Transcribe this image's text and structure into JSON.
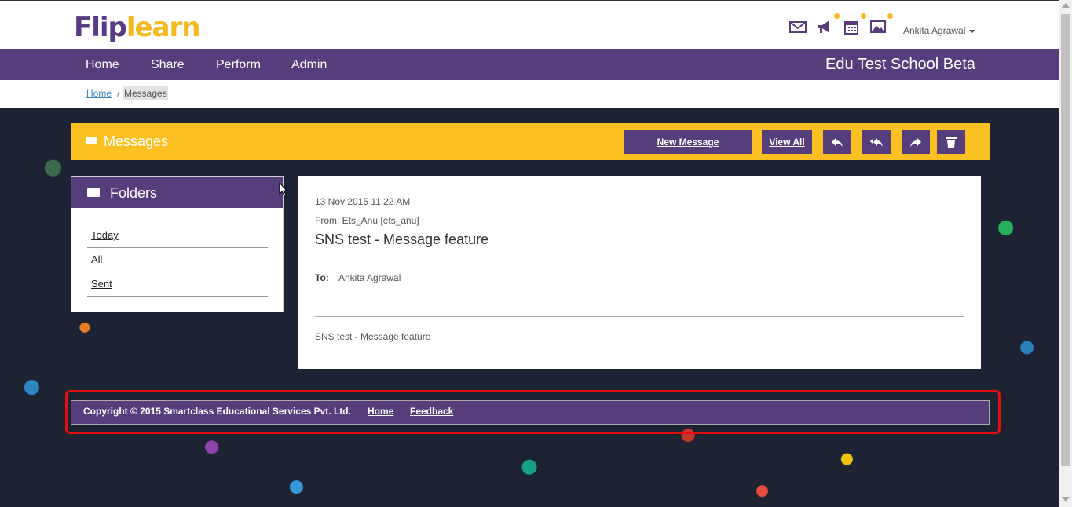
{
  "brand": {
    "logo_part1": "Flip",
    "logo_part2": "learn"
  },
  "header": {
    "user_name": "Ankita Agrawal",
    "icons": [
      "mail-icon",
      "megaphone-icon",
      "calendar-icon",
      "image-icon"
    ]
  },
  "nav": {
    "items": [
      "Home",
      "Share",
      "Perform",
      "Admin"
    ],
    "school": "Edu Test School Beta"
  },
  "breadcrumb": {
    "home": "Home",
    "separator": "/",
    "current": "Messages"
  },
  "messages_bar": {
    "title": "Messages",
    "new_message": "New Message",
    "view_all": "View All"
  },
  "folders": {
    "title": "Folders",
    "items": [
      "Today",
      "All",
      "Sent"
    ]
  },
  "message": {
    "date": "13 Nov 2015 11:22 AM",
    "from": "From: Ets_Anu [ets_anu]",
    "subject": "SNS test - Message feature",
    "to_label": "To:",
    "to": "Ankita Agrawal",
    "body": "SNS test - Message feature"
  },
  "footer": {
    "copyright": "Copyright © 2015 Smartclass Educational Services Pvt. Ltd.",
    "home": "Home",
    "feedback": "Feedback"
  },
  "colors": {
    "brand_purple": "#563d7c",
    "accent_yellow": "#fbc021",
    "annotation_red": "#e01010"
  }
}
